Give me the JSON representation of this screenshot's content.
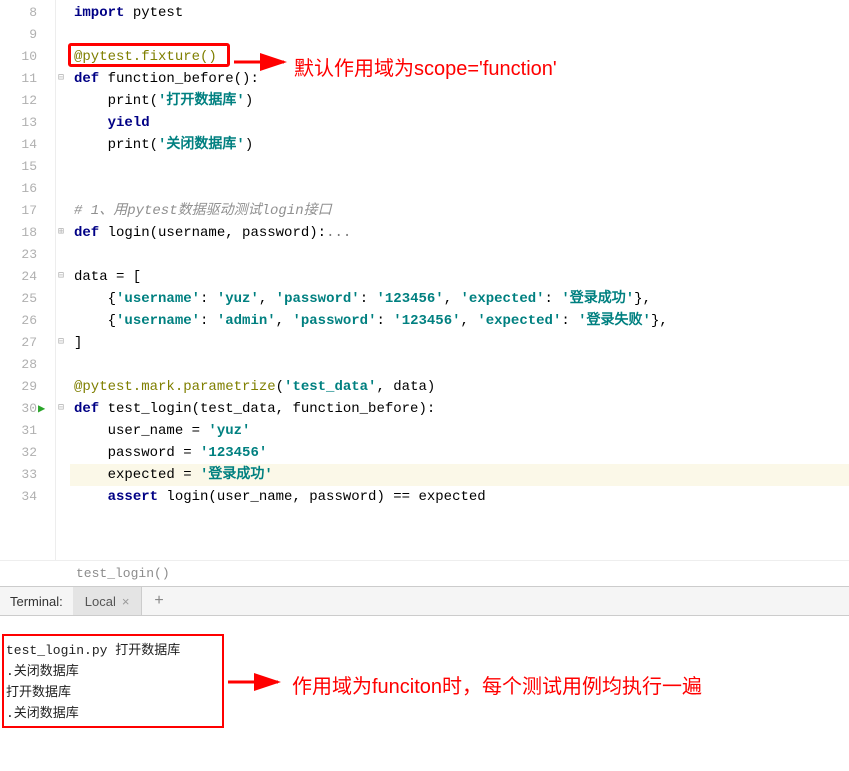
{
  "gutter": [
    "8",
    "9",
    "10",
    "11",
    "12",
    "13",
    "14",
    "15",
    "16",
    "17",
    "18",
    "23",
    "24",
    "25",
    "26",
    "27",
    "28",
    "29",
    "30",
    "31",
    "32",
    "33",
    "34"
  ],
  "code": {
    "l8": "import pytest",
    "l10": "@pytest.fixture()",
    "l11": "def function_before():",
    "l12_a": "    print(",
    "l12_b": "'打开数据库'",
    "l12_c": ")",
    "l13": "    yield",
    "l14_a": "    print(",
    "l14_b": "'关闭数据库'",
    "l14_c": ")",
    "l17": "# 1、用pytest数据驱动测试login接口",
    "l18_a": "def ",
    "l18_b": "login",
    "l18_c": "(username, password):",
    "l18_d": "...",
    "l24": "data = [",
    "l25": "    {'username': 'yuz', 'password': '123456', 'expected': '登录成功'},",
    "l26": "    {'username': 'admin', 'password': '123456', 'expected': '登录失败'},",
    "l27": "]",
    "l29_a": "@pytest.mark.parametrize(",
    "l29_b": "'test_data'",
    "l29_c": ", data)",
    "l30_a": "def ",
    "l30_b": "test_login",
    "l30_c": "(test_data, function_before):",
    "l31_a": "    user_name = ",
    "l31_b": "'yuz'",
    "l32_a": "    password = ",
    "l32_b": "'123456'",
    "l33_a": "    expected = ",
    "l33_b": "'登录成功'",
    "l34_a": "    assert ",
    "l34_b": "login(user_name, password) == expected"
  },
  "crumb": "test_login()",
  "annot1": "默认作用域为scope='function'",
  "annot2": "作用域为funciton时，每个测试用例均执行一遍",
  "terminal": {
    "label": "Terminal:",
    "tab": "Local"
  },
  "output": [
    "test_login.py 打开数据库",
    ".关闭数据库",
    "打开数据库",
    ".关闭数据库"
  ]
}
